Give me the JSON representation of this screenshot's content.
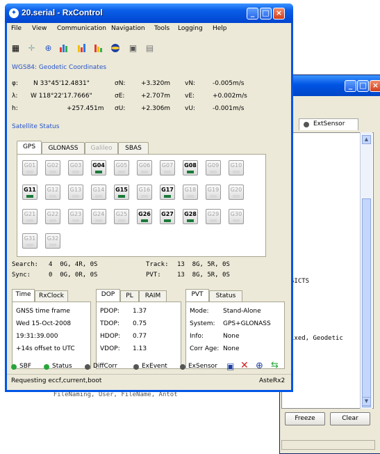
{
  "main_window": {
    "title": "20.serial - RxControl",
    "menu": [
      "File",
      "View",
      "Communication",
      "Navigation",
      "Tools",
      "Logging",
      "Help"
    ],
    "toolbar_icons": [
      "grid-icon",
      "crosshair-icon",
      "target-icon",
      "bar-chart-icon",
      "signal-chart-icon",
      "dish-icon",
      "globe-icon",
      "form-icon",
      "settings-icon"
    ],
    "coords_title": "WGS84: Geodetic Coordinates",
    "coords": [
      {
        "sym": "φ:",
        "val": "N 33°45'12.4831\"",
        "sig": "σN:",
        "sval": "+3.320m",
        "vs": "vN:",
        "vval": "-0.005m/s"
      },
      {
        "sym": "λ:",
        "val": "W 118°22'17.7666\"",
        "sig": "σE:",
        "sval": "+2.707m",
        "vs": "vE:",
        "vval": "+0.002m/s"
      },
      {
        "sym": "h:",
        "val": "+257.451m",
        "sig": "σU:",
        "sval": "+2.306m",
        "vs": "vU:",
        "vval": "-0.001m/s"
      }
    ],
    "sat_title": "Satellite Status",
    "sat_tabs": [
      "GPS",
      "GLONASS",
      "Galileo",
      "SBAS"
    ],
    "satellites": [
      [
        "G01",
        "G02",
        "G03",
        "G04",
        "G05",
        "G06",
        "G07",
        "G08",
        "G09",
        "G10"
      ],
      [
        "G11",
        "G12",
        "G13",
        "G14",
        "G15",
        "G16",
        "G17",
        "G18",
        "G19",
        "G20"
      ],
      [
        "G21",
        "G22",
        "G23",
        "G24",
        "G25",
        "G26",
        "G27",
        "G28",
        "G29",
        "G30"
      ],
      [
        "G31",
        "G32"
      ]
    ],
    "active_sats": [
      "G04",
      "G08",
      "G11",
      "G15",
      "G17",
      "G26",
      "G27",
      "G28"
    ],
    "info": {
      "search_label": "Search:",
      "search_val": "4  0G, 4R, 0S",
      "sync_label": "Sync:",
      "sync_val": "0  0G, 0R, 0S",
      "track_label": "Track:",
      "track_val": "13  8G, 5R, 0S",
      "pvt_label": "PVT:",
      "pvt_val": "13  8G, 5R, 0S"
    },
    "time_panel": {
      "tabs": [
        "Time",
        "RxClock"
      ],
      "lines": [
        "GNSS time frame",
        "Wed 15-Oct-2008",
        "19:31:39.000",
        "+14s offset to UTC"
      ]
    },
    "dop_panel": {
      "tabs": [
        "DOP",
        "PL",
        "RAIM"
      ],
      "rows": [
        [
          "PDOP:",
          "1.37"
        ],
        [
          "TDOP:",
          "0.75"
        ],
        [
          "HDOP:",
          "0.77"
        ],
        [
          "VDOP:",
          "1.13"
        ]
      ]
    },
    "pvt_panel": {
      "tabs": [
        "PVT",
        "Status"
      ],
      "rows": [
        [
          "Mode:",
          "Stand-Alone"
        ],
        [
          "System:",
          "GPS+GLONASS"
        ],
        [
          "Info:",
          "None"
        ],
        [
          "Corr Age:",
          "None"
        ]
      ]
    },
    "statusbar": {
      "items": [
        "SBF",
        "Status",
        "DiffCorr",
        "ExEvent",
        "ExSensor"
      ],
      "message": "Requesting eccf,current,boot",
      "device": "AsteRx2"
    }
  },
  "bg_window": {
    "tab_label": "ExtSensor",
    "text_lines": [
      {
        "t": "SICTS"
      },
      {
        "t": "ixed, Geodetic"
      },
      {
        "t": "  FileNaming, User, FileName, Antot"
      }
    ],
    "freeze_label": "Freeze",
    "clear_label": "Clear"
  },
  "colors": {
    "accent": "#0054e3",
    "group_title": "#2553c9",
    "sat_active_bar": "#1b7a3a",
    "status_green": "#27a53a"
  }
}
